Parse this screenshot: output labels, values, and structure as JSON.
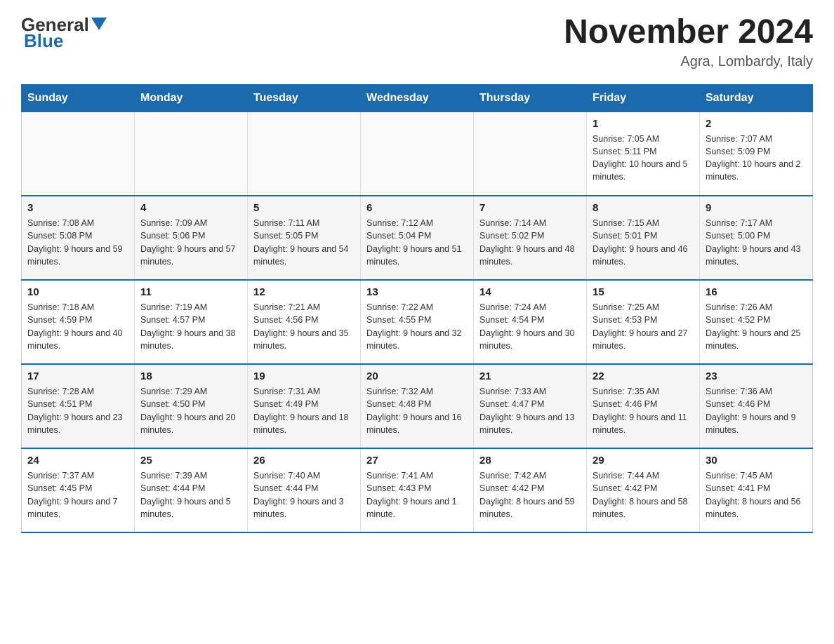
{
  "header": {
    "logo_general": "General",
    "logo_blue": "Blue",
    "month_year": "November 2024",
    "location": "Agra, Lombardy, Italy"
  },
  "days_of_week": [
    "Sunday",
    "Monday",
    "Tuesday",
    "Wednesday",
    "Thursday",
    "Friday",
    "Saturday"
  ],
  "weeks": [
    [
      {
        "num": "",
        "info": ""
      },
      {
        "num": "",
        "info": ""
      },
      {
        "num": "",
        "info": ""
      },
      {
        "num": "",
        "info": ""
      },
      {
        "num": "",
        "info": ""
      },
      {
        "num": "1",
        "info": "Sunrise: 7:05 AM\nSunset: 5:11 PM\nDaylight: 10 hours and 5 minutes."
      },
      {
        "num": "2",
        "info": "Sunrise: 7:07 AM\nSunset: 5:09 PM\nDaylight: 10 hours and 2 minutes."
      }
    ],
    [
      {
        "num": "3",
        "info": "Sunrise: 7:08 AM\nSunset: 5:08 PM\nDaylight: 9 hours and 59 minutes."
      },
      {
        "num": "4",
        "info": "Sunrise: 7:09 AM\nSunset: 5:06 PM\nDaylight: 9 hours and 57 minutes."
      },
      {
        "num": "5",
        "info": "Sunrise: 7:11 AM\nSunset: 5:05 PM\nDaylight: 9 hours and 54 minutes."
      },
      {
        "num": "6",
        "info": "Sunrise: 7:12 AM\nSunset: 5:04 PM\nDaylight: 9 hours and 51 minutes."
      },
      {
        "num": "7",
        "info": "Sunrise: 7:14 AM\nSunset: 5:02 PM\nDaylight: 9 hours and 48 minutes."
      },
      {
        "num": "8",
        "info": "Sunrise: 7:15 AM\nSunset: 5:01 PM\nDaylight: 9 hours and 46 minutes."
      },
      {
        "num": "9",
        "info": "Sunrise: 7:17 AM\nSunset: 5:00 PM\nDaylight: 9 hours and 43 minutes."
      }
    ],
    [
      {
        "num": "10",
        "info": "Sunrise: 7:18 AM\nSunset: 4:59 PM\nDaylight: 9 hours and 40 minutes."
      },
      {
        "num": "11",
        "info": "Sunrise: 7:19 AM\nSunset: 4:57 PM\nDaylight: 9 hours and 38 minutes."
      },
      {
        "num": "12",
        "info": "Sunrise: 7:21 AM\nSunset: 4:56 PM\nDaylight: 9 hours and 35 minutes."
      },
      {
        "num": "13",
        "info": "Sunrise: 7:22 AM\nSunset: 4:55 PM\nDaylight: 9 hours and 32 minutes."
      },
      {
        "num": "14",
        "info": "Sunrise: 7:24 AM\nSunset: 4:54 PM\nDaylight: 9 hours and 30 minutes."
      },
      {
        "num": "15",
        "info": "Sunrise: 7:25 AM\nSunset: 4:53 PM\nDaylight: 9 hours and 27 minutes."
      },
      {
        "num": "16",
        "info": "Sunrise: 7:26 AM\nSunset: 4:52 PM\nDaylight: 9 hours and 25 minutes."
      }
    ],
    [
      {
        "num": "17",
        "info": "Sunrise: 7:28 AM\nSunset: 4:51 PM\nDaylight: 9 hours and 23 minutes."
      },
      {
        "num": "18",
        "info": "Sunrise: 7:29 AM\nSunset: 4:50 PM\nDaylight: 9 hours and 20 minutes."
      },
      {
        "num": "19",
        "info": "Sunrise: 7:31 AM\nSunset: 4:49 PM\nDaylight: 9 hours and 18 minutes."
      },
      {
        "num": "20",
        "info": "Sunrise: 7:32 AM\nSunset: 4:48 PM\nDaylight: 9 hours and 16 minutes."
      },
      {
        "num": "21",
        "info": "Sunrise: 7:33 AM\nSunset: 4:47 PM\nDaylight: 9 hours and 13 minutes."
      },
      {
        "num": "22",
        "info": "Sunrise: 7:35 AM\nSunset: 4:46 PM\nDaylight: 9 hours and 11 minutes."
      },
      {
        "num": "23",
        "info": "Sunrise: 7:36 AM\nSunset: 4:46 PM\nDaylight: 9 hours and 9 minutes."
      }
    ],
    [
      {
        "num": "24",
        "info": "Sunrise: 7:37 AM\nSunset: 4:45 PM\nDaylight: 9 hours and 7 minutes."
      },
      {
        "num": "25",
        "info": "Sunrise: 7:39 AM\nSunset: 4:44 PM\nDaylight: 9 hours and 5 minutes."
      },
      {
        "num": "26",
        "info": "Sunrise: 7:40 AM\nSunset: 4:44 PM\nDaylight: 9 hours and 3 minutes."
      },
      {
        "num": "27",
        "info": "Sunrise: 7:41 AM\nSunset: 4:43 PM\nDaylight: 9 hours and 1 minute."
      },
      {
        "num": "28",
        "info": "Sunrise: 7:42 AM\nSunset: 4:42 PM\nDaylight: 8 hours and 59 minutes."
      },
      {
        "num": "29",
        "info": "Sunrise: 7:44 AM\nSunset: 4:42 PM\nDaylight: 8 hours and 58 minutes."
      },
      {
        "num": "30",
        "info": "Sunrise: 7:45 AM\nSunset: 4:41 PM\nDaylight: 8 hours and 56 minutes."
      }
    ]
  ]
}
